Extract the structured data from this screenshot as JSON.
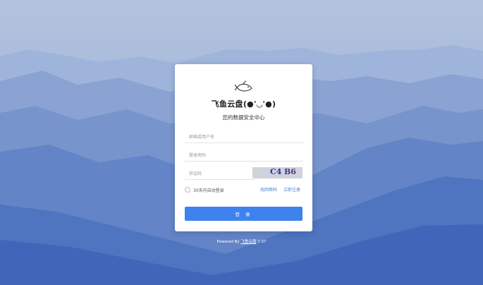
{
  "brand": {
    "title": "飞鱼云盘(●'◡'●)",
    "subtitle": "您的数据安全中心",
    "logo_icon": "fish-logo-icon"
  },
  "form": {
    "username_placeholder": "邮箱或用户名",
    "password_placeholder": "登录密码",
    "captcha_placeholder": "验证码",
    "captcha_chars": [
      "C4",
      "B6"
    ],
    "remember_label": "30天内自动登录",
    "forgot_label": "找回密码",
    "register_label": "立即注册",
    "login_label": "登 录"
  },
  "footer": {
    "prefix": "Powered By",
    "product": "飞鱼云盘",
    "version": "2.07"
  },
  "colors": {
    "accent": "#3e82ee",
    "link": "#4a7fd0",
    "sky_top": "#a9bbd9",
    "mountains": "#4a76c4"
  }
}
